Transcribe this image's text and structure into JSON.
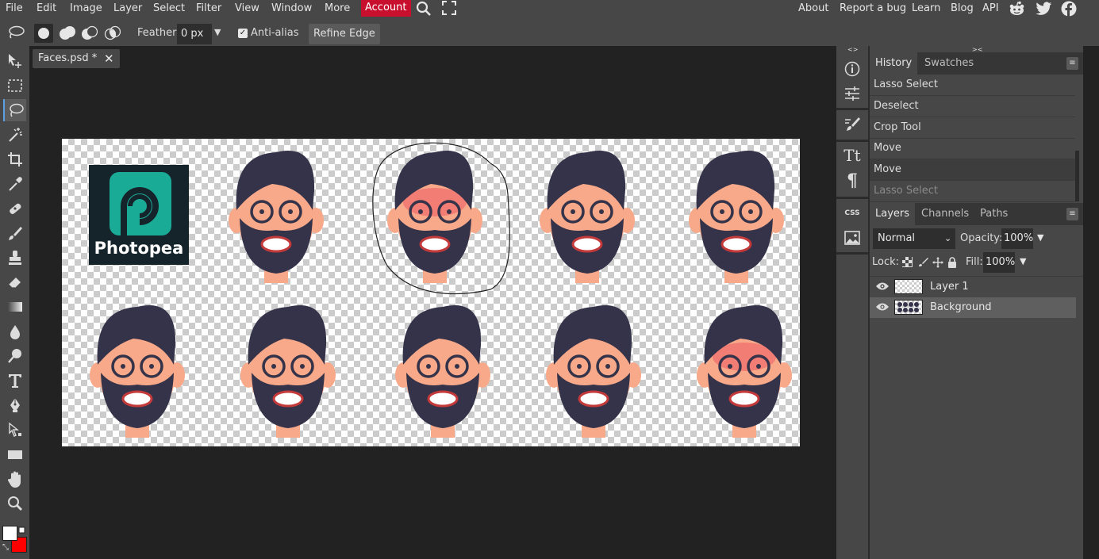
{
  "menu": {
    "items": [
      "File",
      "Edit",
      "Image",
      "Layer",
      "Select",
      "Filter",
      "View",
      "Window",
      "More"
    ],
    "account": "Account",
    "right_links": [
      "About",
      "Report a bug",
      "Learn",
      "Blog",
      "API"
    ],
    "icons": [
      "search-icon",
      "fullscreen-icon",
      "reddit-icon",
      "twitter-icon",
      "facebook-icon"
    ]
  },
  "options": {
    "tool_icon": "lasso-icon",
    "selection_modes": [
      "new-selection-icon",
      "add-selection-icon",
      "subtract-selection-icon",
      "intersect-selection-icon"
    ],
    "feather_label": "Feather:",
    "feather_value": "0 px",
    "antialias_label": "Anti-alias",
    "antialias_checked": true,
    "refine_edge": "Refine Edge"
  },
  "toolbox": {
    "tools": [
      "move-tool-icon",
      "marquee-tool-icon",
      "lasso-tool-icon",
      "magic-wand-icon",
      "crop-tool-icon",
      "eyedropper-icon",
      "healing-brush-icon",
      "brush-icon",
      "clone-stamp-icon",
      "eraser-icon",
      "gradient-icon",
      "blur-icon",
      "dodge-icon",
      "type-tool-icon",
      "pen-tool-icon",
      "path-select-icon",
      "shape-tool-icon",
      "hand-tool-icon",
      "zoom-tool-icon"
    ],
    "active_tool": "lasso-tool-icon",
    "foreground_color": "#ffffff",
    "background_color": "#ff0000"
  },
  "document": {
    "tab_title": "Faces.psd *",
    "logo_text": "Photopea",
    "logo_color": "#1aab96"
  },
  "history": {
    "tabs": [
      "History",
      "Swatches"
    ],
    "active_tab": "History",
    "items": [
      {
        "label": "Lasso Select",
        "state": "normal"
      },
      {
        "label": "Deselect",
        "state": "normal"
      },
      {
        "label": "Crop Tool",
        "state": "normal"
      },
      {
        "label": "Move",
        "state": "normal"
      },
      {
        "label": "Move",
        "state": "selected"
      },
      {
        "label": "Lasso Select",
        "state": "future"
      }
    ]
  },
  "layers_panel": {
    "tabs": [
      "Layers",
      "Channels",
      "Paths"
    ],
    "active_tab": "Layers",
    "blend_mode": "Normal",
    "opacity_label": "Opacity:",
    "opacity": "100%",
    "lock_label": "Lock:",
    "fill_label": "Fill:",
    "fill": "100%",
    "layers": [
      {
        "name": "Layer 1",
        "visible": true,
        "selected": false
      },
      {
        "name": "Background",
        "visible": true,
        "selected": true
      }
    ]
  },
  "side_icons": [
    "info-icon",
    "adjustments-icon",
    "brush-settings-icon",
    "character-icon",
    "paragraph-icon",
    "css-icon",
    "image-icon"
  ],
  "side_icon_text": {
    "character": "Tt",
    "paragraph": "¶",
    "css": "CSS"
  },
  "colors": {
    "accent": "#c8102e",
    "selection_highlight": "#5ba0e0",
    "skin": "#f7a98a",
    "hair": "#353349"
  }
}
